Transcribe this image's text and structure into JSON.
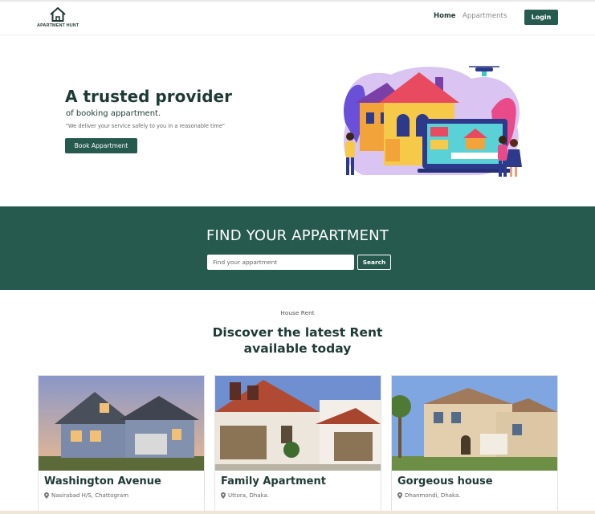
{
  "brand": {
    "name": "APARTMENT HUNT"
  },
  "nav": {
    "home": "Home",
    "apartments": "Appartments",
    "login": "Login"
  },
  "hero": {
    "title": "A trusted provider",
    "subtitle": "of booking appartment.",
    "quote": "\"We deliver your service safely to you in a reasonable time\"",
    "button": "Book Appartment"
  },
  "find": {
    "title": "FIND YOUR APPARTMENT",
    "placeholder": "Find your appartment",
    "search": "Search"
  },
  "rent": {
    "label": "House Rent",
    "heading_line1": "Discover the latest Rent",
    "heading_line2": "available today"
  },
  "cards": [
    {
      "name": "Washington Avenue",
      "location": "Nasirabad H/S, Chattogram"
    },
    {
      "name": "Family Apartment",
      "location": "Uttora, Dhaka."
    },
    {
      "name": "Gorgeous house",
      "location": "Dhanmondi, Dhaka."
    }
  ],
  "colors": {
    "primary": "#275a4f",
    "text": "#1f3a34"
  },
  "icons": [
    "house-logo-icon",
    "map-pin-icon"
  ]
}
